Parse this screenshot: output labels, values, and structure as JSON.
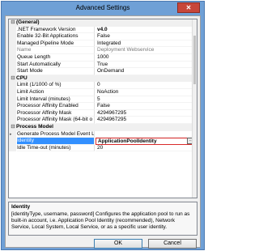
{
  "window": {
    "title": "Advanced Settings",
    "close_glyph": "✕"
  },
  "groups": [
    {
      "toggle": "⊟",
      "title": "(General)",
      "props": [
        {
          "name": ".NET Framework Version",
          "value": "v4.0",
          "bold": true,
          "readonly": false
        },
        {
          "name": "Enable 32-Bit Applications",
          "value": "False",
          "bold": false,
          "readonly": false
        },
        {
          "name": "Managed Pipeline Mode",
          "value": "Integrated",
          "bold": false,
          "readonly": false
        },
        {
          "name": "Name",
          "value": "Deployment Webservice",
          "bold": false,
          "readonly": true
        },
        {
          "name": "Queue Length",
          "value": "1000",
          "bold": false,
          "readonly": false
        },
        {
          "name": "Start Automatically",
          "value": "True",
          "bold": false,
          "readonly": false
        },
        {
          "name": "Start Mode",
          "value": "OnDemand",
          "bold": false,
          "readonly": false
        }
      ]
    },
    {
      "toggle": "⊟",
      "title": "CPU",
      "props": [
        {
          "name": "Limit (1/1000 of %)",
          "value": "0",
          "bold": false,
          "readonly": false
        },
        {
          "name": "Limit Action",
          "value": "NoAction",
          "bold": false,
          "readonly": false
        },
        {
          "name": "Limit Interval (minutes)",
          "value": "5",
          "bold": false,
          "readonly": false
        },
        {
          "name": "Processor Affinity Enabled",
          "value": "False",
          "bold": false,
          "readonly": false
        },
        {
          "name": "Processor Affinity Mask",
          "value": "4294967295",
          "bold": false,
          "readonly": false
        },
        {
          "name": "Processor Affinity Mask (64-bit o",
          "value": "4294967295",
          "bold": false,
          "readonly": false
        }
      ]
    },
    {
      "toggle": "⊟",
      "title": "Process Model",
      "props": [
        {
          "name": "Generate Process Model Event L",
          "value": "",
          "bold": false,
          "readonly": false,
          "expand": "▸"
        },
        {
          "name": "Identity",
          "value": "ApplicationPoolIdentity",
          "bold": true,
          "readonly": false,
          "selected": true
        },
        {
          "name": "Idle Time-out (minutes)",
          "value": "20",
          "bold": false,
          "readonly": false
        }
      ]
    }
  ],
  "ellipsis_label": "...",
  "description": {
    "title": "Identity",
    "text": "[identityType, username, password] Configures the application pool to run as built-in account, i.e. Application Pool Identity (recommended), Network Service, Local System, Local Service, or as a specific user identity."
  },
  "buttons": {
    "ok": "OK",
    "cancel": "Cancel"
  }
}
